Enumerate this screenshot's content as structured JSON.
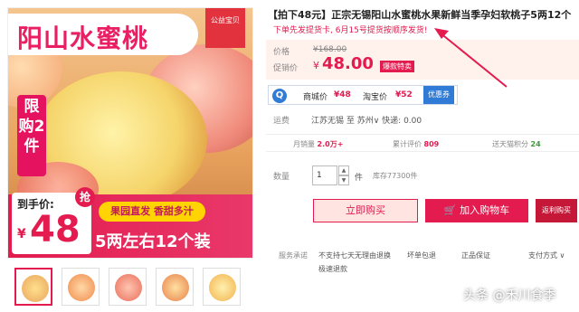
{
  "gallery": {
    "banner_title": "阳山水蜜桃",
    "public_badge": "公益宝贝",
    "limit_text": "限购2件",
    "to_hand_label": "到手价:",
    "grab": "抢",
    "yen": "¥",
    "hand_price": "48",
    "yellow_tag": "果园直发 香甜多汁",
    "bottom_text": "5两左右12个装",
    "thumbnails": [
      "thumb-1",
      "thumb-2",
      "thumb-3",
      "thumb-4",
      "thumb-5"
    ]
  },
  "product": {
    "title": "【拍下48元】正宗无锡阳山水蜜桃水果新鲜当季孕妇软桃子5两12个",
    "subtitle": "下单先发提货卡, 6月15号提货按顺序发货!",
    "price_label": "价格",
    "original_price": "¥168.00",
    "promo_label": "促销价",
    "promo_yen": "¥",
    "promo_price": "48.00",
    "promo_tag": "爆款特卖",
    "compare": {
      "mall_label": "商城价",
      "mall_price": "¥48",
      "taobao_label": "淘宝价",
      "taobao_price": "¥52",
      "button": "优惠券"
    },
    "shipping_label": "运费",
    "shipping_text": "江苏无锡 至 苏州∨ 快递: 0.00",
    "stats": {
      "monthly_label": "月销量",
      "monthly_value": "2.0万+",
      "reviews_label": "累计评价",
      "reviews_value": "809",
      "points_label": "送天猫积分",
      "points_value": "24"
    },
    "qty_label": "数量",
    "qty_value": "1",
    "qty_unit": "件",
    "stock": "库存77300件",
    "buy_now": "立即购买",
    "add_cart": "加入购物车",
    "return_btn": "返利购买",
    "service_label": "服务承诺",
    "services": [
      "不支持七天无理由退换",
      "坏单包退",
      "正品保证",
      "极速退款"
    ],
    "pay_label": "支付方式 ∨"
  },
  "watermark": "头条 @禾川食季",
  "colors": {
    "accent": "#e31b4f",
    "blue": "#2f7bd6"
  }
}
